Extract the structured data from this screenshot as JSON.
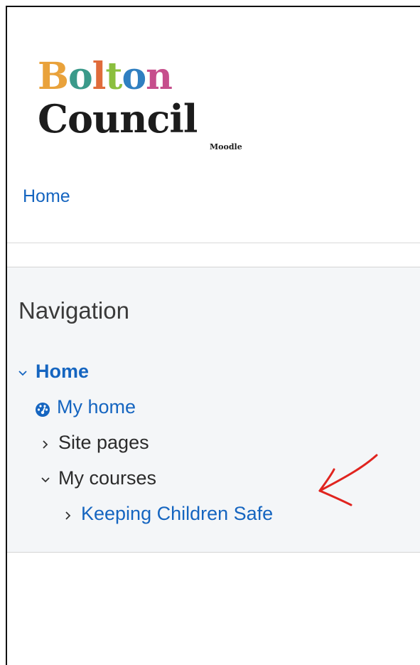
{
  "branding": {
    "logo_line1": "Bolton",
    "logo_line2": "Council",
    "logo_sub": "Moodle",
    "logo_letter_colors": [
      "#e9a23b",
      "#3b9a8a",
      "#e06b3a",
      "#8bbf3e",
      "#2f7fc1",
      "#c64e8c"
    ]
  },
  "header": {
    "home_link": "Home"
  },
  "navigation": {
    "title": "Navigation",
    "home": "Home",
    "my_home": "My home",
    "site_pages": "Site pages",
    "my_courses": "My courses",
    "course": "Keeping Children Safe"
  },
  "colors": {
    "link": "#1565c0",
    "annotation": "#e0241f",
    "block_bg": "#f4f6f8"
  }
}
